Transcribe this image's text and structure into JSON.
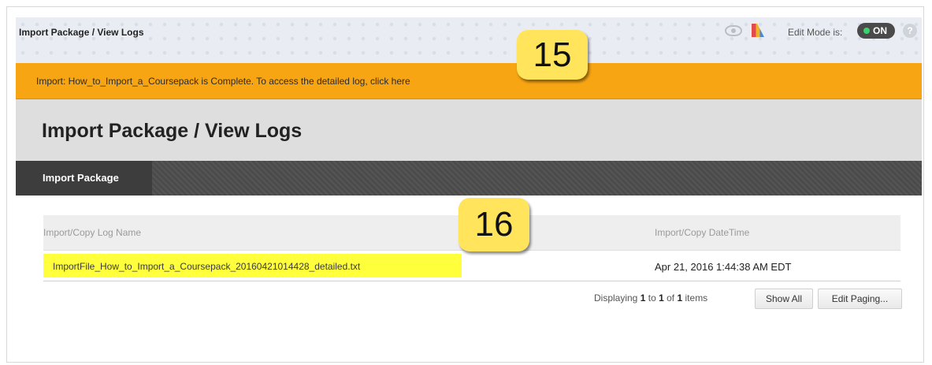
{
  "topbar": {
    "breadcrumb": "Import Package / View Logs",
    "edit_mode_label": "Edit Mode is:",
    "edit_mode_state": "ON",
    "help_glyph": "?",
    "icons": [
      "eye-icon",
      "palette-icon",
      "help-icon"
    ]
  },
  "receipt": {
    "message": "Import: How_to_Import_a_Coursepack is Complete. To access the detailed log, click here",
    "color": "#f7a512"
  },
  "callouts": {
    "step15": "15",
    "step16": "16"
  },
  "page": {
    "title": "Import Package / View Logs"
  },
  "nav": {
    "tab_label": "Import Package"
  },
  "table": {
    "headers": [
      "Import/Copy Log Name",
      "Import/Copy DateTime"
    ],
    "rows": [
      {
        "name": "ImportFile_How_to_Import_a_Coursepack_20160421014428_detailed.txt",
        "datetime": "Apr 21, 2016 1:44:38 AM EDT"
      }
    ]
  },
  "paging": {
    "prefix": "Displaying",
    "from": "1",
    "to_word": "to",
    "to": "1",
    "of_word": "of",
    "total": "1",
    "suffix": "items",
    "show_all_label": "Show All",
    "edit_paging_label": "Edit Paging..."
  },
  "colors": {
    "highlight": "#ffff3b",
    "callout": "#ffe45c",
    "toggle_on": "#3bd16f"
  }
}
